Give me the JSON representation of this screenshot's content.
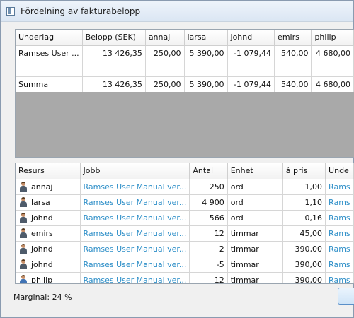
{
  "window": {
    "title": "Fördelning av fakturabelopp"
  },
  "top_table": {
    "columns": [
      "Underlag",
      "Belopp (SEK)",
      "annaj",
      "larsa",
      "johnd",
      "emirs",
      "philip"
    ],
    "rows": [
      [
        "Ramses User ...",
        "13 426,35",
        "250,00",
        "5 390,00",
        "-1 079,44",
        "540,00",
        "4 680,00"
      ],
      [
        "",
        "",
        "",
        "",
        "",
        "",
        ""
      ],
      [
        "Summa",
        "13 426,35",
        "250,00",
        "5 390,00",
        "-1 079,44",
        "540,00",
        "4 680,00"
      ]
    ]
  },
  "bottom_table": {
    "columns": [
      "Resurs",
      "Jobb",
      "Antal",
      "Enhet",
      "á pris",
      "Unde"
    ],
    "rows": [
      {
        "resurs": "annaj",
        "jobb": "Ramses User Manual ver...",
        "antal": "250",
        "enhet": "ord",
        "pris": "1,00",
        "unde": "Rams"
      },
      {
        "resurs": "larsa",
        "jobb": "Ramses User Manual ver...",
        "antal": "4 900",
        "enhet": "ord",
        "pris": "1,10",
        "unde": "Rams"
      },
      {
        "resurs": "johnd",
        "jobb": "Ramses User Manual ver...",
        "antal": "566",
        "enhet": "ord",
        "pris": "0,16",
        "unde": "Rams"
      },
      {
        "resurs": "emirs",
        "jobb": "Ramses User Manual ver...",
        "antal": "12",
        "enhet": "timmar",
        "pris": "45,00",
        "unde": "Rams"
      },
      {
        "resurs": "johnd",
        "jobb": "Ramses User Manual ver...",
        "antal": "2",
        "enhet": "timmar",
        "pris": "390,00",
        "unde": "Rams"
      },
      {
        "resurs": "johnd",
        "jobb": "Ramses User Manual ver...",
        "antal": "-5",
        "enhet": "timmar",
        "pris": "390,00",
        "unde": "Rams"
      },
      {
        "resurs": "philip",
        "jobb": "Ramses User Manual ver...",
        "antal": "12",
        "enhet": "timmar",
        "pris": "390,00",
        "unde": "Rams"
      }
    ]
  },
  "status": {
    "margin_label": "Marginal: 24 %"
  },
  "icons": {
    "app": "window-app-icon",
    "resource": "person-icon"
  },
  "colors": {
    "link": "#2e8fc8",
    "empty_area": "#a9a9a9"
  }
}
